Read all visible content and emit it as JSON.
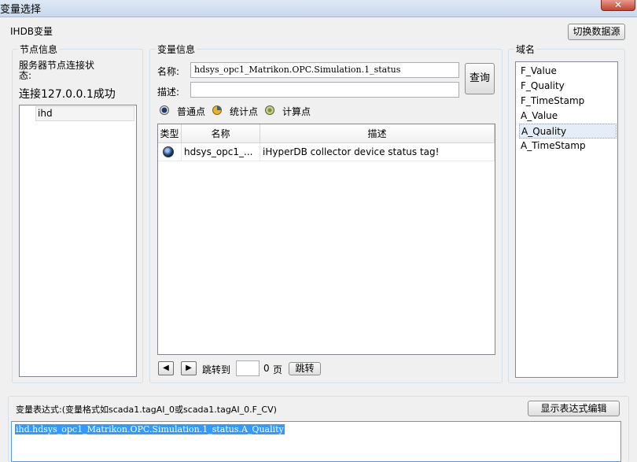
{
  "window": {
    "title": "变量选择",
    "close_glyph": "✕"
  },
  "header": {
    "app_label": "IHDB变量",
    "switch_source_button": "切换数据源"
  },
  "node_info": {
    "group_title": "节点信息",
    "status_label": "服务器节点连接状态:",
    "status_value": "连接127.0.0.1成功",
    "nodes": [
      "ihd"
    ]
  },
  "var_info": {
    "group_title": "变量信息",
    "name_label": "名称:",
    "name_value": "hdsys_opc1_Matrikon.OPC.Simulation.1_status",
    "desc_label": "描述:",
    "desc_value": "",
    "query_button": "查询",
    "point_types": [
      {
        "label": "普通点",
        "icon": "normal-point-icon",
        "selected": true
      },
      {
        "label": "统计点",
        "icon": "stat-point-icon",
        "selected": false
      },
      {
        "label": "计算点",
        "icon": "calc-point-icon",
        "selected": false
      }
    ],
    "table": {
      "columns": [
        "类型",
        "名称",
        "描述"
      ],
      "rows": [
        {
          "type_icon": "normal-point-icon",
          "name": "hdsys_opc1_...",
          "desc": "iHyperDB collector device status tag!"
        }
      ]
    },
    "pagination": {
      "prev": "◀",
      "next": "▶",
      "goto_label": "跳转到",
      "page_input": "",
      "page_count": "0",
      "page_unit": "页",
      "jump_button": "跳转"
    }
  },
  "domain": {
    "group_title": "域名",
    "items": [
      "F_Value",
      "F_Quality",
      "F_TimeStamp",
      "A_Value",
      "A_Quality",
      "A_TimeStamp"
    ],
    "selected": "A_Quality"
  },
  "expression": {
    "label": "变量表达式:(变量格式如scada1.tagAI_0或scada1.tagAI_0.F_CV)",
    "show_editor_button": "显示表达式编辑",
    "value": "ihd.hdsys_opc1_Matrikon.OPC.Simulation.1_status.A_Quality"
  }
}
